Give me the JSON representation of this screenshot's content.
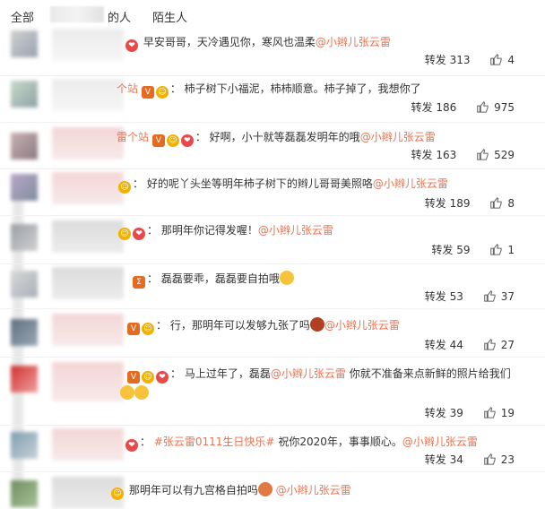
{
  "filters": {
    "all": "全部",
    "following": "的人",
    "stranger": "陌生人"
  },
  "repost_label": "转发",
  "comments": [
    {
      "text": "早安哥哥，天冷遇见你，寒风也温柔",
      "mention": "@小辫儿张云雷",
      "reposts": "313",
      "likes": "4"
    },
    {
      "nick_tail": "个站",
      "text": "柿子树下小福泥，柿柿顺意。柿子掉了，我想你了",
      "reposts": "186",
      "likes": "975"
    },
    {
      "nick_tail": "雷个站",
      "text": "好啊，小十就等磊磊发明年的哦",
      "mention": "@小辫儿张云雷",
      "reposts": "163",
      "likes": "529"
    },
    {
      "text": "好的呢丫头坐等明年柿子树下的辫儿哥哥美照咯",
      "mention": "@小辫儿张云雷",
      "reposts": "189",
      "likes": "8"
    },
    {
      "text": "那明年你记得发喔！",
      "mention": "@小辫儿张云雷",
      "reposts": "59",
      "likes": "1"
    },
    {
      "text": "磊磊要乖，磊磊要自拍哦",
      "reposts": "53",
      "likes": "37"
    },
    {
      "text": "行，那明年可以发够九张了吗",
      "mention": "@小辫儿张云雷",
      "reposts": "44",
      "likes": "27"
    },
    {
      "text": "马上过年了，磊磊",
      "mention": "@小辫儿张云雷",
      "text2": "你就不准备来点新鲜的照片给我们",
      "reposts": "39",
      "likes": "19"
    },
    {
      "tag": "#张云雷0111生日快乐#",
      "text": "祝你2020年，事事顺心。",
      "mention": "@小辫儿张云雷",
      "reposts": "34",
      "likes": "23"
    },
    {
      "text": "那明年可以有九宫格自拍吗",
      "mention": "@小辫儿张云雷"
    }
  ],
  "colors": {
    "accent": "#eb7350",
    "text": "#333333",
    "divider": "#f0f0f0"
  }
}
